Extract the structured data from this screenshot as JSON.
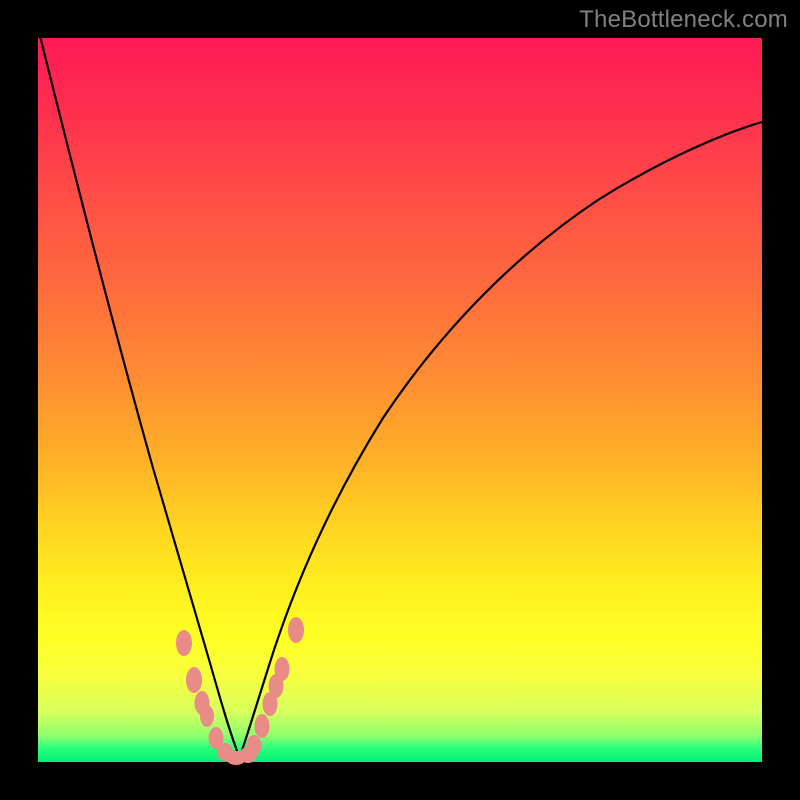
{
  "watermark": "TheBottleneck.com",
  "chart_data": {
    "type": "line",
    "title": "",
    "xlabel": "",
    "ylabel": "",
    "xlim": [
      0,
      100
    ],
    "ylim": [
      0,
      100
    ],
    "grid": false,
    "legend": false,
    "gradient_colors": {
      "top": "#ff1a55",
      "mid_upper": "#ff8d32",
      "mid_lower": "#ffff24",
      "bottom": "#00f07a"
    },
    "series": [
      {
        "name": "bottleneck-curve-left",
        "x": [
          0,
          5,
          10,
          14,
          18,
          21,
          23.5,
          25.5,
          27
        ],
        "y": [
          100,
          78,
          56,
          38,
          23,
          12,
          5.5,
          1.8,
          0.2
        ]
      },
      {
        "name": "bottleneck-curve-right",
        "x": [
          27,
          29,
          32,
          36,
          42,
          50,
          60,
          72,
          86,
          100
        ],
        "y": [
          0.2,
          2.5,
          8,
          17,
          30,
          45,
          59,
          71,
          81,
          88
        ]
      }
    ],
    "markers": {
      "name": "highlight-dots",
      "color": "#e98b86",
      "points_xy": [
        [
          20.2,
          16.2
        ],
        [
          21.6,
          11.2
        ],
        [
          22.6,
          8.0
        ],
        [
          23.2,
          6.2
        ],
        [
          24.6,
          3.2
        ],
        [
          25.8,
          1.4
        ],
        [
          27.3,
          0.3
        ],
        [
          28.8,
          0.6
        ],
        [
          29.5,
          1.9
        ],
        [
          30.8,
          4.5
        ],
        [
          31.9,
          7.5
        ],
        [
          32.7,
          10.0
        ],
        [
          33.4,
          12.3
        ],
        [
          35.5,
          17.8
        ]
      ]
    }
  }
}
